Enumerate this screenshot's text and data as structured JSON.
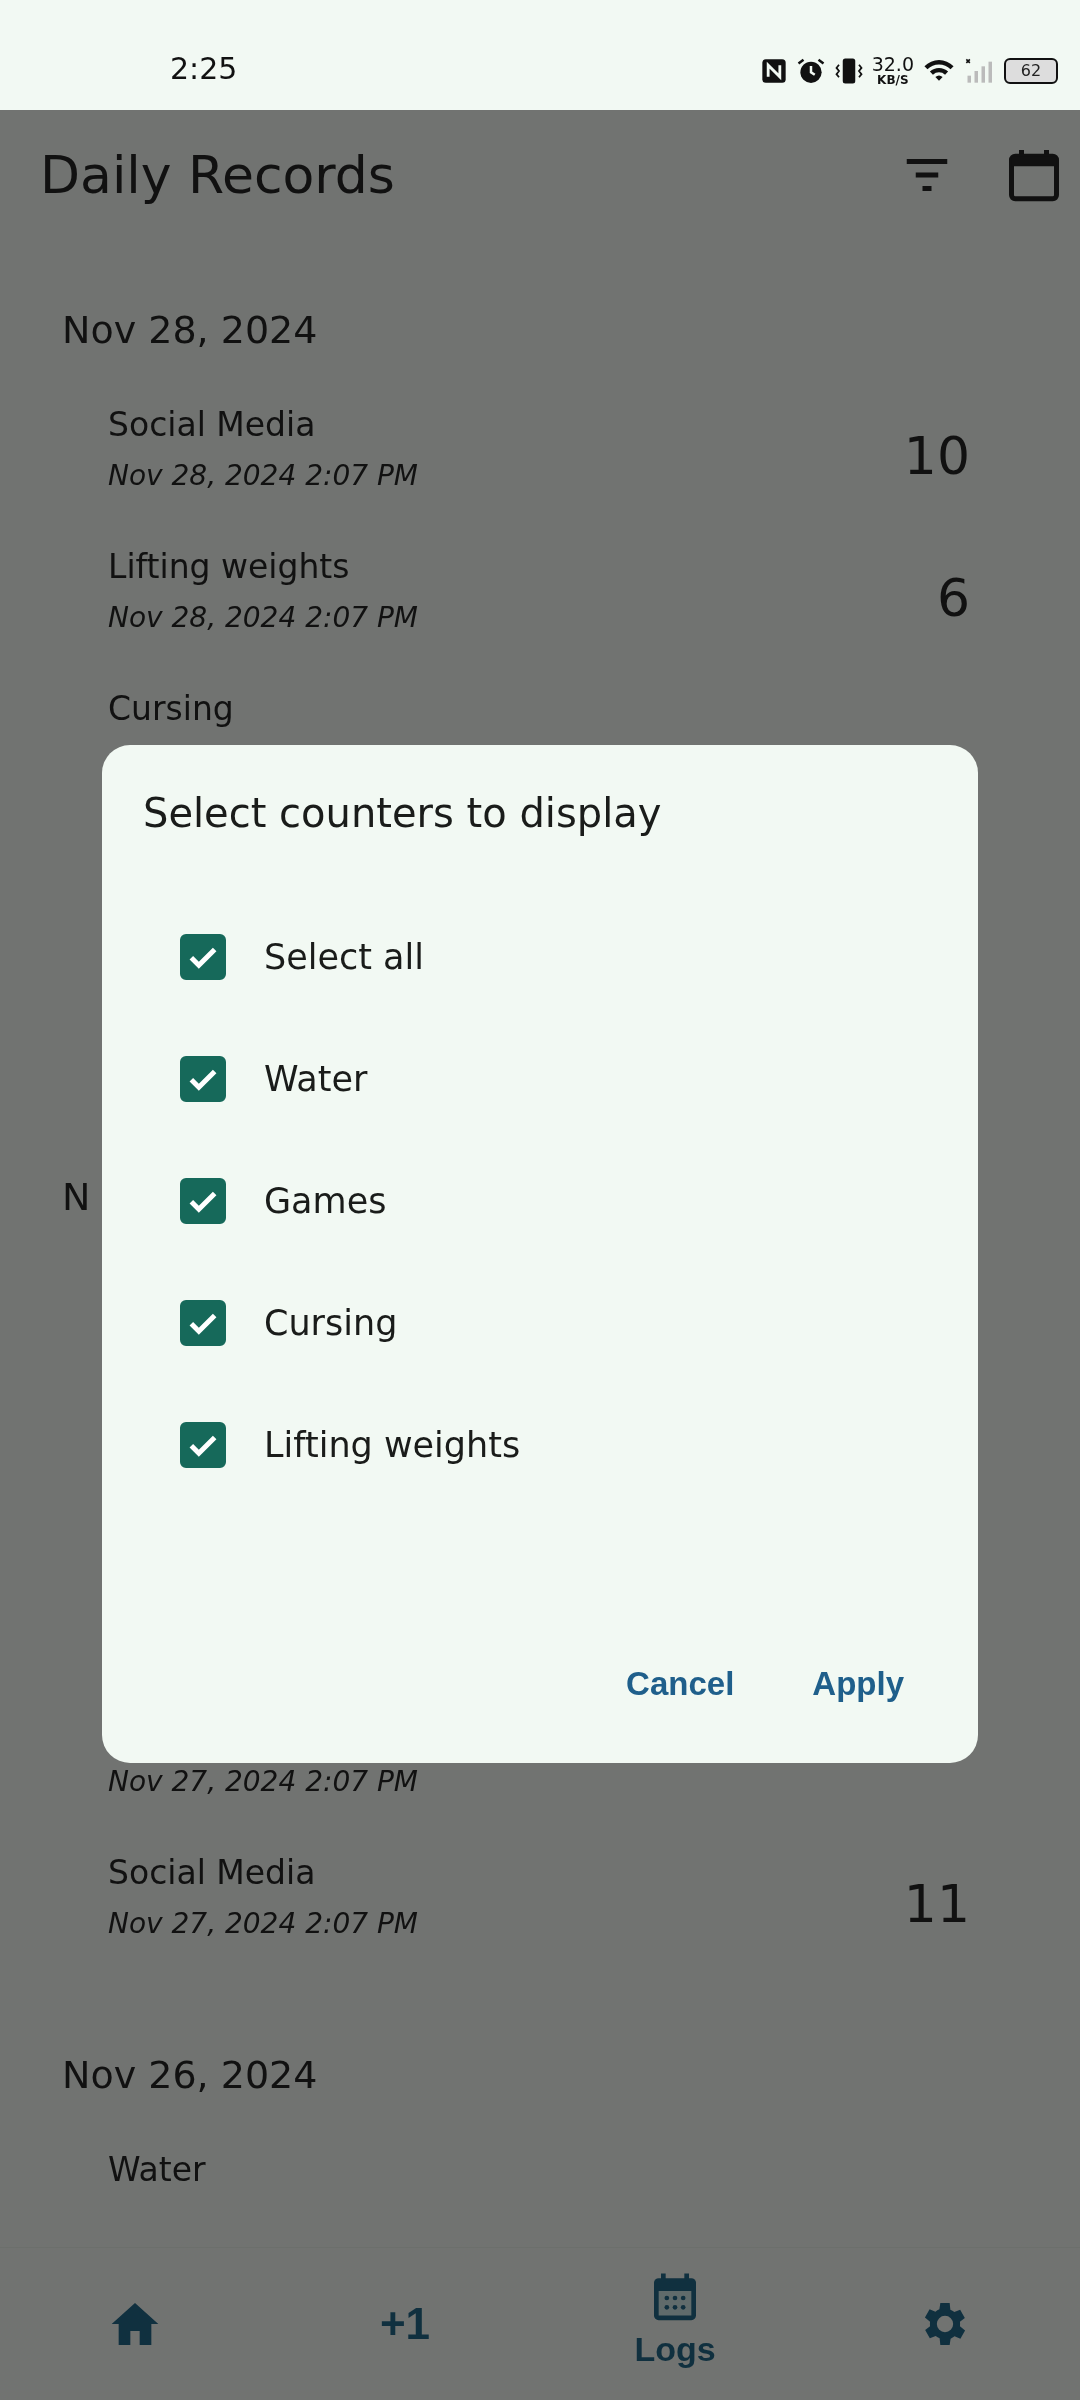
{
  "status_bar": {
    "time": "2:25",
    "speed": "32.0",
    "speed_unit": "KB/S",
    "battery": "62"
  },
  "app_bar": {
    "title": "Daily Records"
  },
  "sections": [
    {
      "date": "Nov 28, 2024",
      "items": [
        {
          "name": "Social Media",
          "time": "Nov 28, 2024 2:07 PM",
          "count": "10"
        },
        {
          "name": "Lifting weights",
          "time": "Nov 28, 2024 2:07 PM",
          "count": "6"
        },
        {
          "name": "Cursing"
        }
      ]
    },
    {
      "date": "N",
      "items": [
        {
          "time": "Nov 27, 2024 2:07 PM"
        },
        {
          "name": "Social Media",
          "time": "Nov 27, 2024 2:07 PM",
          "count": "11"
        }
      ]
    },
    {
      "date": "Nov 26, 2024",
      "items": [
        {
          "name": "Water"
        }
      ]
    }
  ],
  "dialog": {
    "title": "Select counters to display",
    "options": [
      {
        "label": "Select all",
        "checked": true
      },
      {
        "label": "Water",
        "checked": true
      },
      {
        "label": "Games",
        "checked": true
      },
      {
        "label": "Cursing",
        "checked": true
      },
      {
        "label": "Lifting weights",
        "checked": true
      }
    ],
    "buttons": [
      "Cancel",
      "Apply"
    ]
  },
  "nav": {
    "items": [
      {
        "kind": "home",
        "selected": false
      },
      {
        "kind": "text",
        "text": "+1",
        "selected": false
      },
      {
        "kind": "calendar",
        "label": "Logs",
        "selected": true
      },
      {
        "kind": "gear",
        "selected": false
      }
    ]
  }
}
